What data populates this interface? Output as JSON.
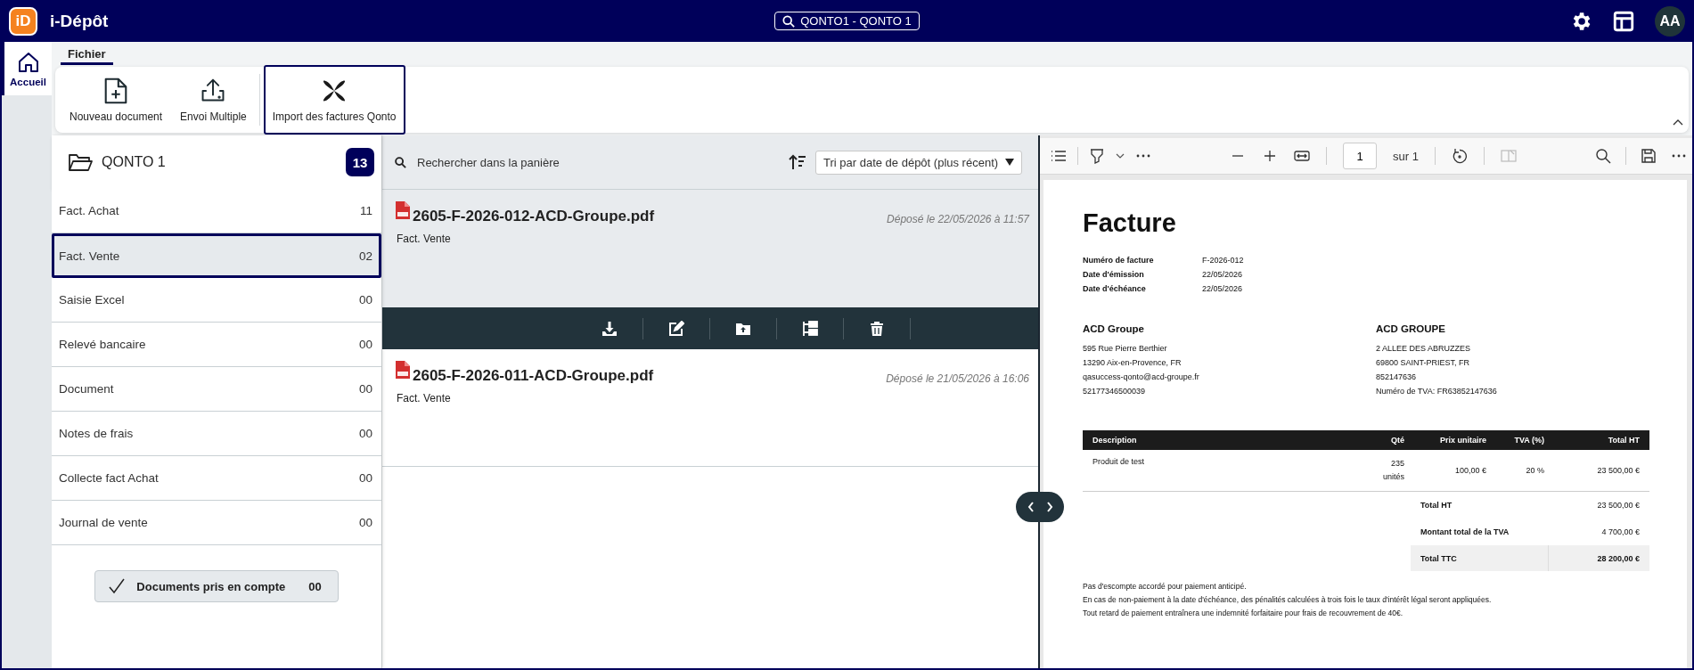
{
  "header": {
    "logo": "iD",
    "title": "i-Dépôt",
    "search": "QONTO1 - QONTO 1",
    "avatar": "AA"
  },
  "rail": [
    {
      "label": "Accueil",
      "selected": true
    }
  ],
  "ribbon": {
    "tabs": [
      {
        "label": "Fichier",
        "selected": true
      }
    ],
    "buttons": [
      {
        "label": "Nouveau document",
        "kind": "new-document",
        "selected": false
      },
      {
        "label": "Envoi Multiple",
        "kind": "upload",
        "selected": false
      },
      {
        "label": "Import des factures Qonto",
        "kind": "qonto",
        "selected": true
      }
    ]
  },
  "folder": {
    "name": "QONTO 1",
    "count": "13",
    "categories": [
      {
        "label": "Fact. Achat",
        "count": "11",
        "selected": false
      },
      {
        "label": "Fact. Vente",
        "count": "02",
        "selected": true
      },
      {
        "label": "Saisie Excel",
        "count": "00",
        "selected": false
      },
      {
        "label": "Relevé bancaire",
        "count": "00",
        "selected": false
      },
      {
        "label": "Document",
        "count": "00",
        "selected": false
      },
      {
        "label": "Notes de frais",
        "count": "00",
        "selected": false
      },
      {
        "label": "Collecte fact Achat",
        "count": "00",
        "selected": false
      },
      {
        "label": "Journal de vente",
        "count": "00",
        "selected": false
      }
    ],
    "accounted": {
      "label": "Documents pris en compte",
      "count": "00"
    }
  },
  "documents": {
    "search_placeholder": "Rechercher dans la panière",
    "sort": "Tri par date de dépôt (plus récent)",
    "items": [
      {
        "name": "2605-F-2026-012-ACD-Groupe.pdf",
        "category": "Fact. Vente",
        "date": "Déposé le 22/05/2026 à 11:57",
        "selected": true
      },
      {
        "name": "2605-F-2026-011-ACD-Groupe.pdf",
        "category": "Fact. Vente",
        "date": "Déposé le 21/05/2026 à 16:06",
        "selected": false
      }
    ]
  },
  "viewer": {
    "page": "1",
    "page_total": "sur 1",
    "invoice": {
      "title": "Facture",
      "meta": [
        {
          "label": "Numéro de facture",
          "value": "F-2026-012"
        },
        {
          "label": "Date d'émission",
          "value": "22/05/2026"
        },
        {
          "label": "Date d'échéance",
          "value": "22/05/2026"
        }
      ],
      "seller": {
        "name": "ACD Groupe",
        "lines": [
          "595 Rue Pierre Berthier",
          "13290 Aix-en-Provence, FR",
          "qasuccess-qonto@acd-groupe.fr",
          "52177346500039"
        ]
      },
      "buyer": {
        "name": "ACD GROUPE",
        "lines": [
          "2 ALLEE DES ABRUZZES",
          "69800 SAINT-PRIEST, FR",
          "852147636",
          "Numéro de TVA: FR63852147636"
        ]
      },
      "columns": [
        "Description",
        "Qté",
        "Prix unitaire",
        "TVA (%)",
        "Total HT"
      ],
      "rows": [
        [
          "Produit de test",
          "235 unités",
          "100,00 €",
          "20 %",
          "23 500,00 €"
        ]
      ],
      "totals": [
        {
          "label": "Total HT",
          "value": "23 500,00 €",
          "highlight": false
        },
        {
          "label": "Montant total de la TVA",
          "value": "4 700,00 €",
          "highlight": false
        },
        {
          "label": "Total TTC",
          "value": "28 200,00 €",
          "highlight": true
        }
      ],
      "notes": [
        "Pas d'escompte accordé pour paiement anticipé.",
        "En cas de non-paiement à la date d'échéance, des pénalités calculées à trois fois le taux d'intérêt légal seront appliquées.",
        "Tout retard de paiement entraînera une indemnité forfaitaire pour frais de recouvrement de 40€."
      ]
    }
  }
}
